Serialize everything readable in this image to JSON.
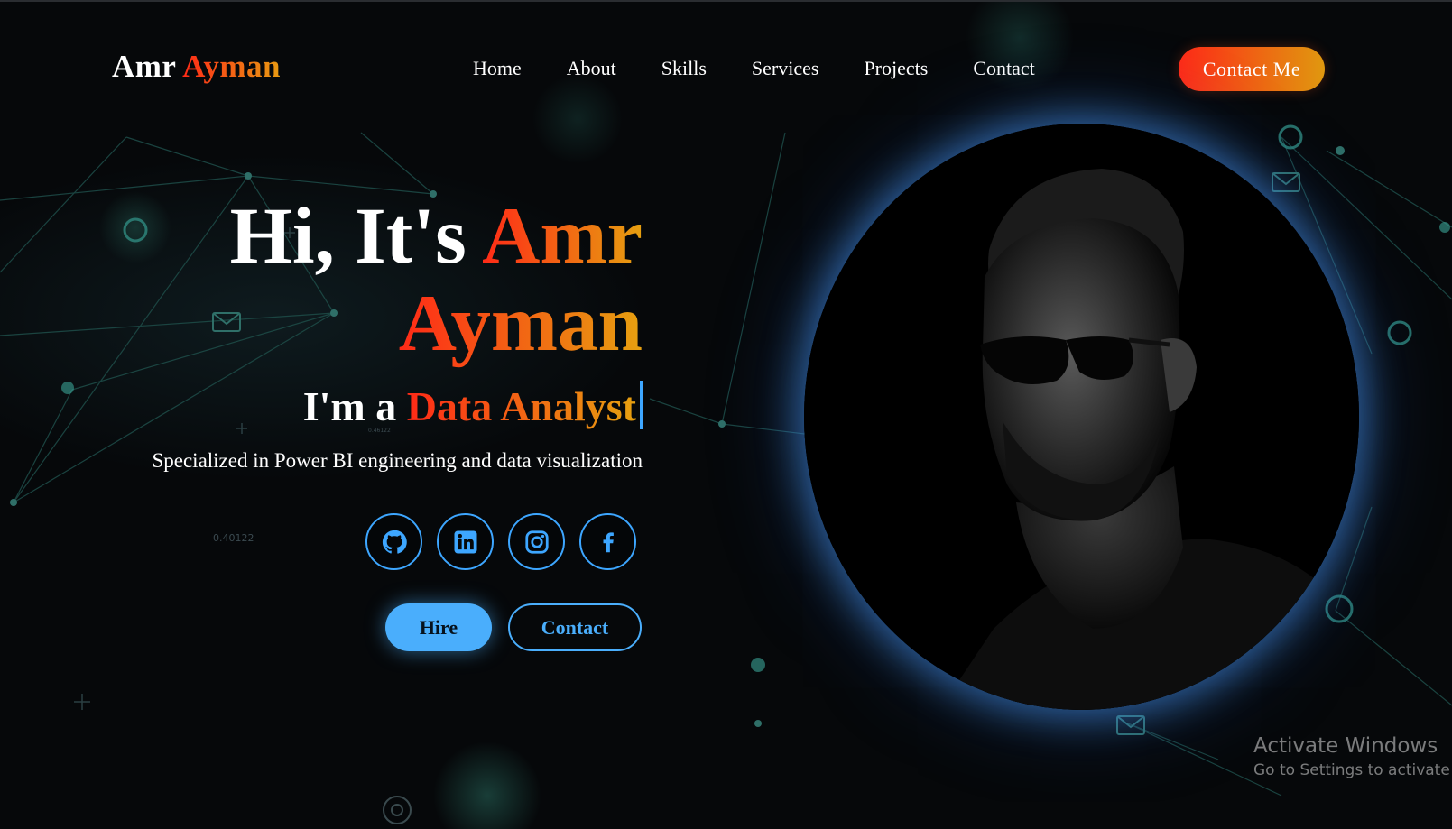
{
  "brand": {
    "first": "Amr",
    "last": "Ayman"
  },
  "nav": {
    "items": [
      {
        "label": "Home"
      },
      {
        "label": "About"
      },
      {
        "label": "Skills"
      },
      {
        "label": "Services"
      },
      {
        "label": "Projects"
      },
      {
        "label": "Contact"
      }
    ],
    "cta_label": "Contact Me"
  },
  "hero": {
    "greeting": "Hi, It's",
    "name_first": "Amr",
    "name_last": "Ayman",
    "role_prefix": "I'm a",
    "role": "Data Analyst",
    "tagline": "Specialized in Power BI engineering and data visualization",
    "background_numbers": [
      "0.40122",
      "0.46122"
    ]
  },
  "socials": [
    {
      "name": "github",
      "icon": "github-icon"
    },
    {
      "name": "linkedin",
      "icon": "linkedin-icon"
    },
    {
      "name": "instagram",
      "icon": "instagram-icon"
    },
    {
      "name": "facebook",
      "icon": "facebook-icon"
    }
  ],
  "actions": {
    "hire_label": "Hire",
    "contact_label": "Contact"
  },
  "watermark": {
    "title": "Activate Windows",
    "subtitle": "Go to Settings to activate Windows."
  },
  "colors": {
    "background": "#06080a",
    "accent_gradient_start": "#ff2a17",
    "accent_gradient_end": "#e6a010",
    "blue": "#4aaefc"
  }
}
